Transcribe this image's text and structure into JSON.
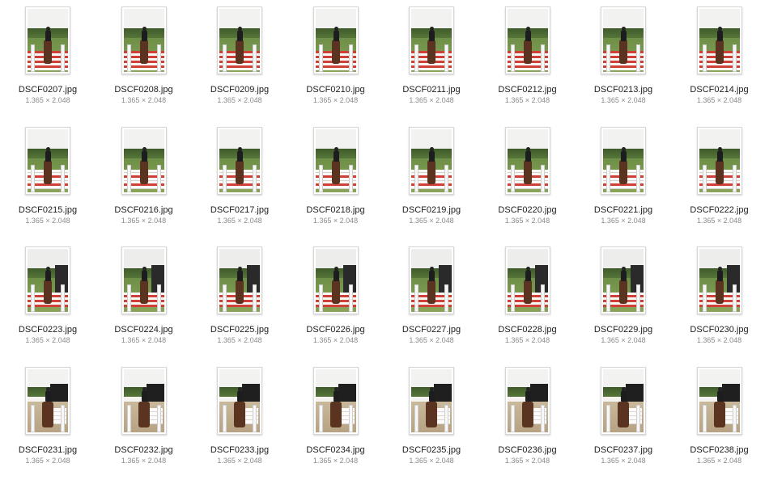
{
  "files": [
    {
      "name": "DSCF0207.jpg",
      "dims": "1.365 × 2.048"
    },
    {
      "name": "DSCF0208.jpg",
      "dims": "1.365 × 2.048"
    },
    {
      "name": "DSCF0209.jpg",
      "dims": "1.365 × 2.048"
    },
    {
      "name": "DSCF0210.jpg",
      "dims": "1.365 × 2.048"
    },
    {
      "name": "DSCF0211.jpg",
      "dims": "1.365 × 2.048"
    },
    {
      "name": "DSCF0212.jpg",
      "dims": "1.365 × 2.048"
    },
    {
      "name": "DSCF0213.jpg",
      "dims": "1.365 × 2.048"
    },
    {
      "name": "DSCF0214.jpg",
      "dims": "1.365 × 2.048"
    },
    {
      "name": "DSCF0215.jpg",
      "dims": "1.365 × 2.048"
    },
    {
      "name": "DSCF0216.jpg",
      "dims": "1.365 × 2.048"
    },
    {
      "name": "DSCF0217.jpg",
      "dims": "1.365 × 2.048"
    },
    {
      "name": "DSCF0218.jpg",
      "dims": "1.365 × 2.048"
    },
    {
      "name": "DSCF0219.jpg",
      "dims": "1.365 × 2.048"
    },
    {
      "name": "DSCF0220.jpg",
      "dims": "1.365 × 2.048"
    },
    {
      "name": "DSCF0221.jpg",
      "dims": "1.365 × 2.048"
    },
    {
      "name": "DSCF0222.jpg",
      "dims": "1.365 × 2.048"
    },
    {
      "name": "DSCF0223.jpg",
      "dims": "1.365 × 2.048"
    },
    {
      "name": "DSCF0224.jpg",
      "dims": "1.365 × 2.048"
    },
    {
      "name": "DSCF0225.jpg",
      "dims": "1.365 × 2.048"
    },
    {
      "name": "DSCF0226.jpg",
      "dims": "1.365 × 2.048"
    },
    {
      "name": "DSCF0227.jpg",
      "dims": "1.365 × 2.048"
    },
    {
      "name": "DSCF0228.jpg",
      "dims": "1.365 × 2.048"
    },
    {
      "name": "DSCF0229.jpg",
      "dims": "1.365 × 2.048"
    },
    {
      "name": "DSCF0230.jpg",
      "dims": "1.365 × 2.048"
    },
    {
      "name": "DSCF0231.jpg",
      "dims": "1.365 × 2.048"
    },
    {
      "name": "DSCF0232.jpg",
      "dims": "1.365 × 2.048"
    },
    {
      "name": "DSCF0233.jpg",
      "dims": "1.365 × 2.048"
    },
    {
      "name": "DSCF0234.jpg",
      "dims": "1.365 × 2.048"
    },
    {
      "name": "DSCF0235.jpg",
      "dims": "1.365 × 2.048"
    },
    {
      "name": "DSCF0236.jpg",
      "dims": "1.365 × 2.048"
    },
    {
      "name": "DSCF0237.jpg",
      "dims": "1.365 × 2.048"
    },
    {
      "name": "DSCF0238.jpg",
      "dims": "1.365 × 2.048"
    }
  ]
}
